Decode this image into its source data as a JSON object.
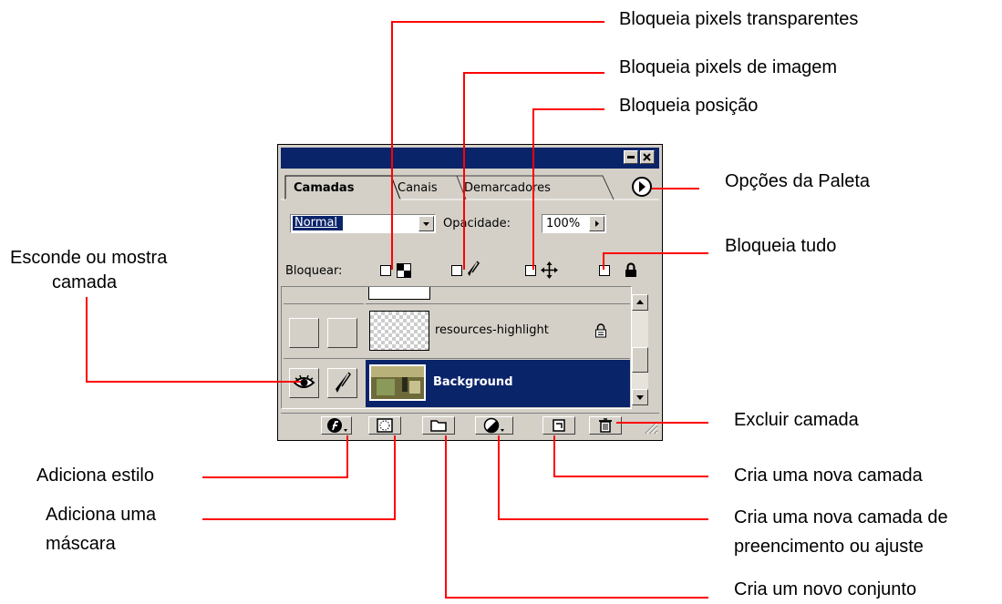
{
  "annotations": {
    "lock_transparent": "Bloqueia pixels transparentes",
    "lock_image": "Bloqueia pixels de imagem",
    "lock_position": "Bloqueia posição",
    "palette_options": "Opções da Paleta",
    "lock_all": "Bloqueia tudo",
    "toggle_visibility_line1": "Esconde ou mostra",
    "toggle_visibility_line2": "camada",
    "delete_layer": "Excluir camada",
    "add_style": "Adiciona estilo",
    "new_layer": "Cria uma nova camada",
    "add_mask_line1": "Adiciona uma",
    "add_mask_line2": "máscara",
    "new_fill_line1": "Cria uma nova camada de",
    "new_fill_line2": "preencimento ou ajuste",
    "new_set": "Cria um novo conjunto"
  },
  "palette": {
    "tabs": [
      "Camadas",
      "Canais",
      "Demarcadores"
    ],
    "blend_mode": "Normal",
    "opacity_label": "Opacidade:",
    "opacity_value": "100%",
    "lock_label": "Bloquear:",
    "layers": [
      {
        "name": "resources-highlight",
        "locked": true,
        "selected": false,
        "visible": false
      },
      {
        "name": "Background",
        "locked": false,
        "selected": true,
        "visible": true
      }
    ]
  },
  "colors": {
    "leader_line": "#ff0000",
    "title_bar": "#0a246a",
    "panel": "#d4d0c8",
    "selection": "#0a246a"
  }
}
